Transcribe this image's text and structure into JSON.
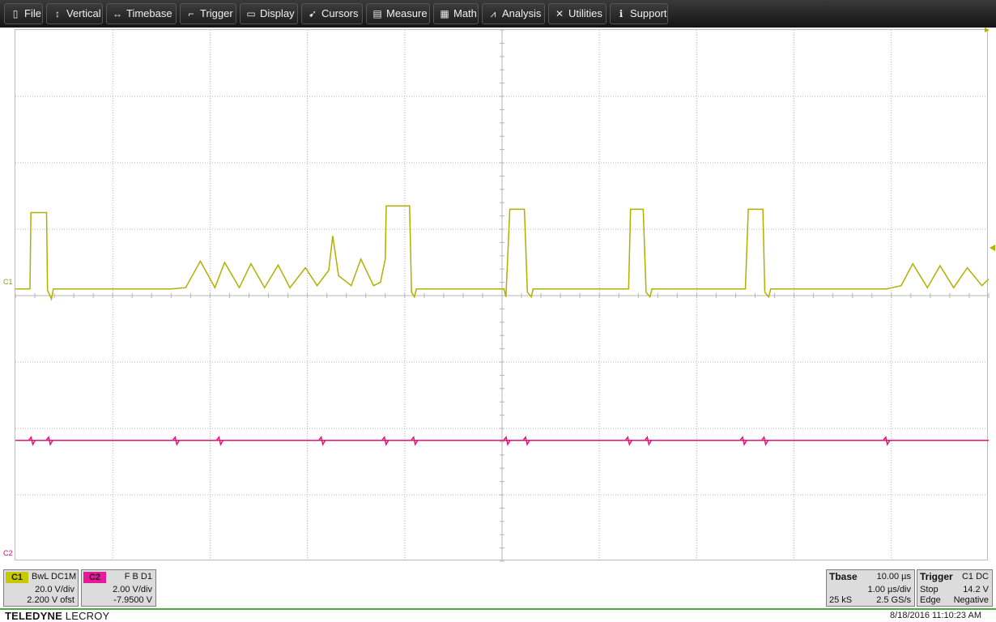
{
  "menu": [
    {
      "id": "file",
      "icon": "clipboard-icon",
      "glyph": "▯",
      "label": "File"
    },
    {
      "id": "vertical",
      "icon": "vertical-arrows-icon",
      "glyph": "↕",
      "label": "Vertical"
    },
    {
      "id": "timebase",
      "icon": "horizontal-arrows-icon",
      "glyph": "↔",
      "label": "Timebase"
    },
    {
      "id": "trigger",
      "icon": "trigger-flag-icon",
      "glyph": "⌐",
      "label": "Trigger"
    },
    {
      "id": "display",
      "icon": "monitor-icon",
      "glyph": "▭",
      "label": "Display"
    },
    {
      "id": "cursors",
      "icon": "cursor-arrow-icon",
      "glyph": "➹",
      "label": "Cursors"
    },
    {
      "id": "measure",
      "icon": "document-icon",
      "glyph": "▤",
      "label": "Measure"
    },
    {
      "id": "math",
      "icon": "calculator-icon",
      "glyph": "▦",
      "label": "Math"
    },
    {
      "id": "analysis",
      "icon": "chart-icon",
      "glyph": "⩘",
      "label": "Analysis"
    },
    {
      "id": "utilities",
      "icon": "tools-icon",
      "glyph": "✕",
      "label": "Utilities"
    },
    {
      "id": "support",
      "icon": "info-icon",
      "glyph": "ℹ",
      "label": "Support"
    }
  ],
  "channels": {
    "c1": {
      "label": "C1",
      "color": "#b0b000",
      "marker": "C1",
      "coupling": "BwL  DC1M",
      "scale": "20.0 V/div",
      "offset": "2.200 V ofst"
    },
    "c2": {
      "label": "C2",
      "color": "#e0147a",
      "marker": "C2",
      "coupling": "F  B  D1",
      "scale": "2.00 V/div",
      "offset": "-7.9500 V"
    }
  },
  "timebase": {
    "title": "Tbase",
    "delay": "10.00 µs",
    "scale": "1.00 µs/div",
    "samples": "25 kS",
    "rate": "2.5 GS/s"
  },
  "trigger": {
    "title": "Trigger",
    "source": "C1  DC",
    "mode": "Stop",
    "level": "14.2 V",
    "type": "Edge",
    "slope": "Negative"
  },
  "brand": {
    "bold": "TELEDYNE",
    "rest": " LECROY"
  },
  "timestamp": "8/18/2016 11:10:23 AM",
  "colors": {
    "grid": "#b4b4b4",
    "trigger_marker": "#b0b000"
  },
  "chart_data": {
    "type": "line",
    "x_unit": "µs",
    "xlim": [
      0,
      10
    ],
    "divisions": {
      "x": 10,
      "y": 8
    },
    "series": [
      {
        "name": "C1",
        "y_unit": "divisions from center",
        "points": [
          [
            0,
            0.1
          ],
          [
            0.15,
            0.1
          ],
          [
            0.16,
            1.25
          ],
          [
            0.32,
            1.25
          ],
          [
            0.33,
            0.08
          ],
          [
            0.37,
            -0.05
          ],
          [
            0.39,
            0.1
          ],
          [
            1.6,
            0.1
          ],
          [
            1.75,
            0.12
          ],
          [
            1.9,
            0.52
          ],
          [
            2.05,
            0.12
          ],
          [
            2.15,
            0.5
          ],
          [
            2.3,
            0.12
          ],
          [
            2.42,
            0.48
          ],
          [
            2.56,
            0.12
          ],
          [
            2.7,
            0.46
          ],
          [
            2.82,
            0.12
          ],
          [
            2.98,
            0.42
          ],
          [
            3.1,
            0.15
          ],
          [
            3.22,
            0.38
          ],
          [
            3.26,
            0.9
          ],
          [
            3.32,
            0.3
          ],
          [
            3.45,
            0.15
          ],
          [
            3.55,
            0.55
          ],
          [
            3.68,
            0.15
          ],
          [
            3.75,
            0.2
          ],
          [
            3.8,
            0.55
          ],
          [
            3.81,
            1.35
          ],
          [
            4.05,
            1.35
          ],
          [
            4.07,
            0.05
          ],
          [
            4.1,
            -0.02
          ],
          [
            4.12,
            0.1
          ],
          [
            5.02,
            0.1
          ],
          [
            5.04,
            -0.02
          ],
          [
            5.08,
            1.3
          ],
          [
            5.23,
            1.3
          ],
          [
            5.26,
            0.05
          ],
          [
            5.3,
            -0.02
          ],
          [
            5.32,
            0.1
          ],
          [
            6.3,
            0.1
          ],
          [
            6.32,
            1.3
          ],
          [
            6.45,
            1.3
          ],
          [
            6.48,
            0.05
          ],
          [
            6.52,
            -0.02
          ],
          [
            6.54,
            0.1
          ],
          [
            7.5,
            0.1
          ],
          [
            7.53,
            1.3
          ],
          [
            7.68,
            1.3
          ],
          [
            7.7,
            0.05
          ],
          [
            7.74,
            -0.02
          ],
          [
            7.76,
            0.1
          ],
          [
            8.95,
            0.1
          ],
          [
            9.1,
            0.15
          ],
          [
            9.22,
            0.48
          ],
          [
            9.37,
            0.12
          ],
          [
            9.5,
            0.45
          ],
          [
            9.64,
            0.12
          ],
          [
            9.78,
            0.42
          ],
          [
            9.93,
            0.15
          ],
          [
            10,
            0.25
          ]
        ]
      },
      {
        "name": "C2",
        "y_unit": "divisions from center",
        "baseline": -2.18,
        "glitches_at": [
          0.17,
          0.35,
          1.65,
          2.1,
          3.15,
          3.8,
          4.1,
          5.05,
          5.25,
          6.3,
          6.5,
          7.48,
          7.7,
          8.95
        ]
      }
    ]
  }
}
